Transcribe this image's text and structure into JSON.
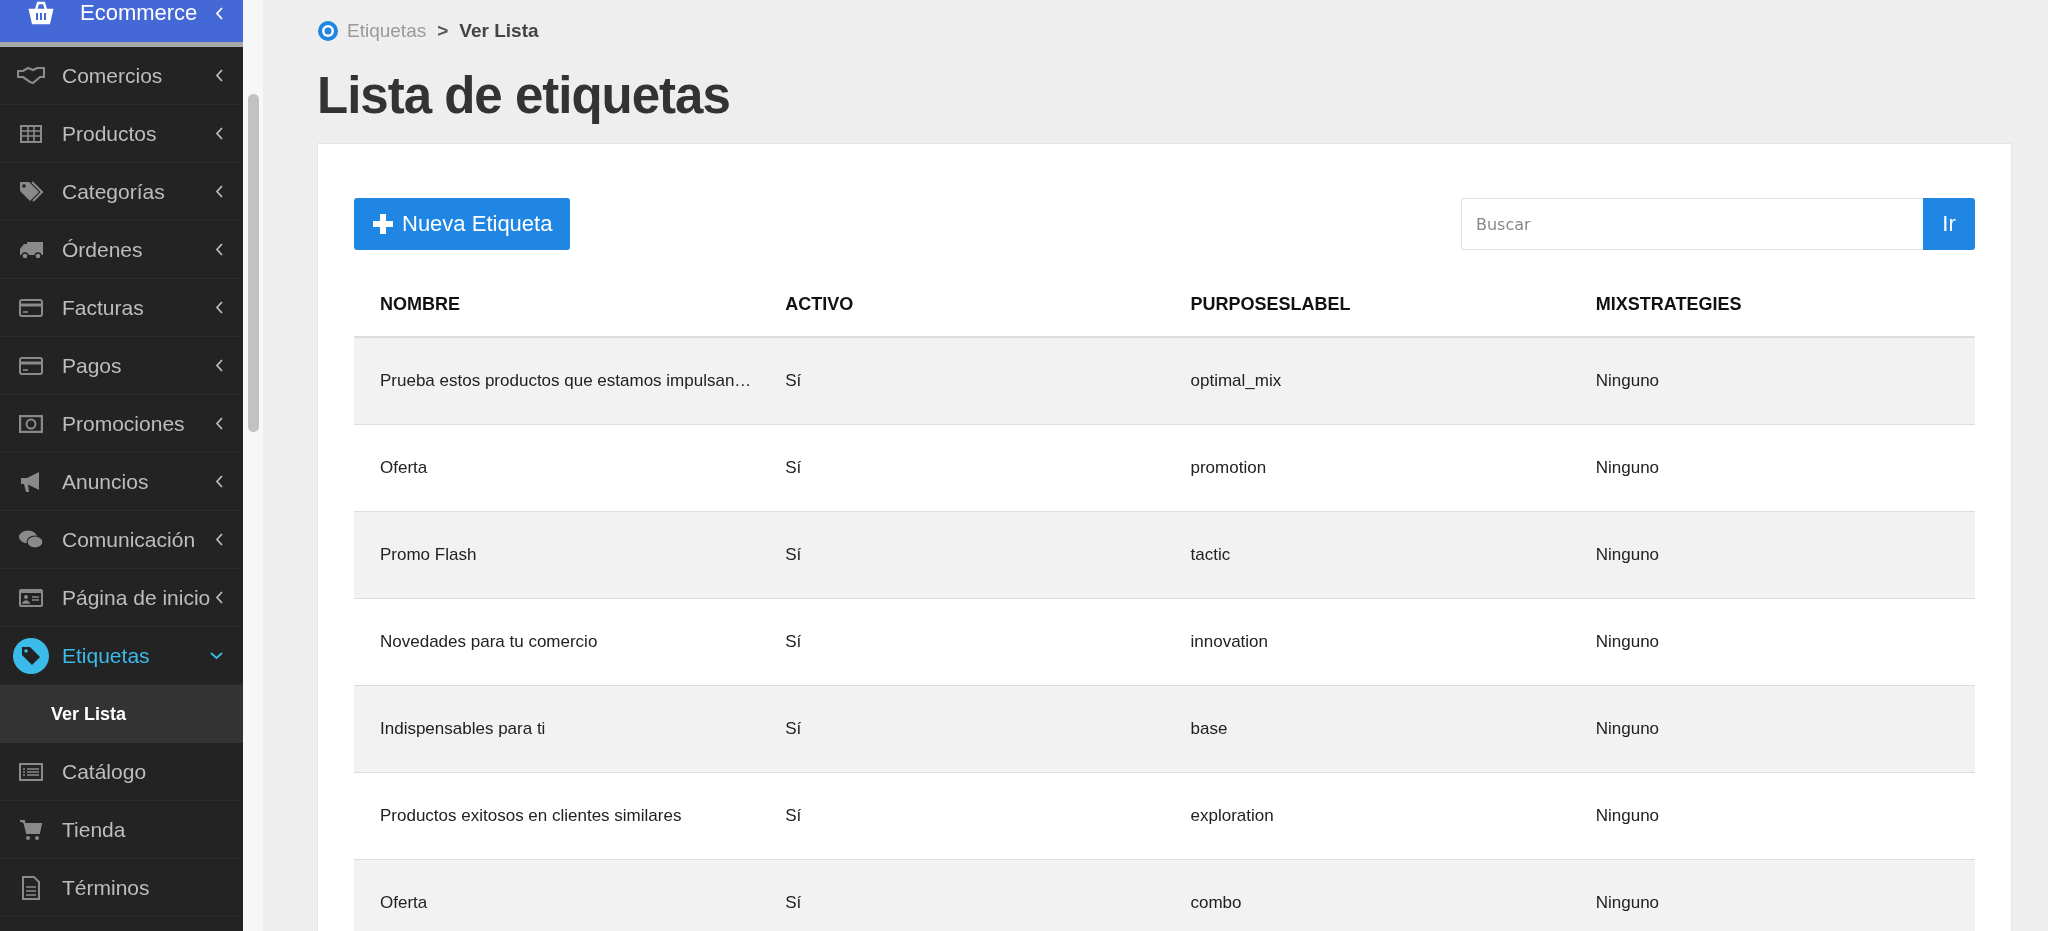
{
  "sidebar": {
    "header": {
      "label": "Ecommerce"
    },
    "items": [
      {
        "label": "Comercios",
        "expanded": false
      },
      {
        "label": "Productos",
        "expanded": false
      },
      {
        "label": "Categorías",
        "expanded": false
      },
      {
        "label": "Órdenes",
        "expanded": false
      },
      {
        "label": "Facturas",
        "expanded": false
      },
      {
        "label": "Pagos",
        "expanded": false
      },
      {
        "label": "Promociones",
        "expanded": false
      },
      {
        "label": "Anuncios",
        "expanded": false
      },
      {
        "label": "Comunicación",
        "expanded": false
      },
      {
        "label": "Página de inicio",
        "expanded": false
      },
      {
        "label": "Etiquetas",
        "expanded": true,
        "children": [
          {
            "label": "Ver Lista",
            "selected": true
          }
        ]
      },
      {
        "label": "Catálogo"
      },
      {
        "label": "Tienda"
      },
      {
        "label": "Términos"
      }
    ]
  },
  "breadcrumb": [
    {
      "label": "Etiquetas"
    },
    {
      "label": ">"
    },
    {
      "label": "Ver Lista"
    }
  ],
  "title": "Lista de etiquetas",
  "new_button": {
    "label": "Nueva Etiqueta"
  },
  "search": {
    "placeholder": "Buscar",
    "button": "Ir"
  },
  "table": {
    "columns": [
      "NOMBRE",
      "ACTIVO",
      "PURPOSESLABEL",
      "MIXSTRATEGIES"
    ],
    "rows": [
      [
        "Prueba estos productos que estamos impulsan…",
        "Sí",
        "optimal_mix",
        "Ninguno"
      ],
      [
        "Oferta",
        "Sí",
        "promotion",
        "Ninguno"
      ],
      [
        "Promo Flash",
        "Sí",
        "tactic",
        "Ninguno"
      ],
      [
        "Novedades para tu comercio",
        "Sí",
        "innovation",
        "Ninguno"
      ],
      [
        "Indispensables para ti",
        "Sí",
        "base",
        "Ninguno"
      ],
      [
        "Productos exitosos en clientes similares",
        "Sí",
        "exploration",
        "Ninguno"
      ],
      [
        "Oferta",
        "Sí",
        "combo",
        "Ninguno"
      ]
    ]
  }
}
